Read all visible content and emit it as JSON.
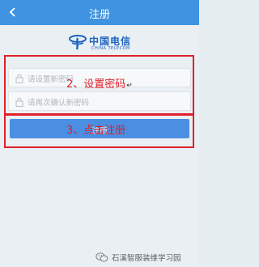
{
  "header": {
    "title": "注册"
  },
  "logo": {
    "name_cn": "中国电信",
    "name_en": "CHINA TELECOM"
  },
  "form": {
    "new_password_placeholder": "请设置新密码",
    "confirm_password_placeholder": "请再次确认新密码",
    "submit_label": "注册"
  },
  "annotations": {
    "step2": "2、设置密码",
    "step2_mark": "↵",
    "step3": "3、点击注册"
  },
  "watermark": {
    "text": "石溪智服装维学习园"
  },
  "colors": {
    "header": "#3f93e0",
    "button": "#4b8fe2",
    "annotation": "#e0202a",
    "brand": "#1e63bf"
  }
}
